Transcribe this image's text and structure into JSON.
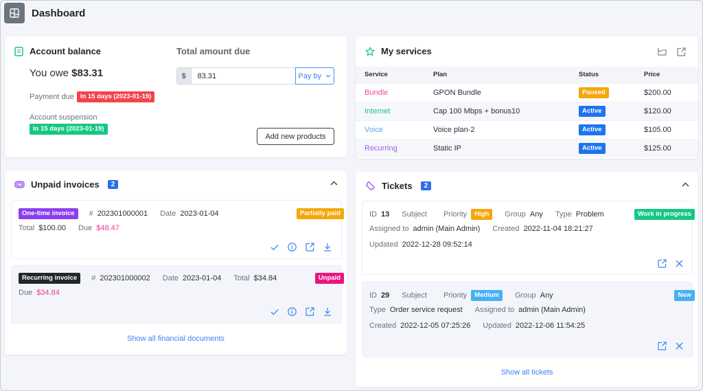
{
  "header": {
    "title": "Dashboard",
    "icon": "dashboard-layout-icon"
  },
  "account_balance": {
    "title": "Account balance",
    "icon": "receipt-icon",
    "you_owe_label": "You owe",
    "you_owe_amount": "$83.31",
    "payment_due_label": "Payment due",
    "payment_due_badge": "In 15 days (2023-01-19)",
    "suspension_label": "Account suspension",
    "suspension_badge": "In 15 days (2023-01-19)",
    "total_title": "Total amount due",
    "currency_symbol": "$",
    "amount_value": "83.31",
    "pay_by_label": "Pay by",
    "add_products_label": "Add new products"
  },
  "services": {
    "title": "My services",
    "icon": "star-icon",
    "actions": [
      "chart-icon",
      "external-link-icon"
    ],
    "columns": [
      "Service",
      "Plan",
      "Status",
      "Price"
    ],
    "rows": [
      {
        "service": "Bundle",
        "service_color": "#e8508e",
        "plan": "GPON Bundle",
        "status": "Paused",
        "status_color": "#f5a70a",
        "price": "$200.00"
      },
      {
        "service": "Internet",
        "service_color": "#19c38a",
        "plan": "Cap 100 Mbps + bonus10",
        "status": "Active",
        "status_color": "#1e74f0",
        "price": "$120.00"
      },
      {
        "service": "Voice",
        "service_color": "#5aa9f5",
        "plan": "Voice plan-2",
        "status": "Active",
        "status_color": "#1e74f0",
        "price": "$105.00"
      },
      {
        "service": "Recurring",
        "service_color": "#9b5cf0",
        "plan": "Static IP",
        "status": "Active",
        "status_color": "#1e74f0",
        "price": "$125.00"
      }
    ]
  },
  "invoices": {
    "title": "Unpaid invoices",
    "count": "2",
    "icon": "invoice-icon",
    "items": [
      {
        "type": "One-time invoice",
        "type_color": "#8a3ff0",
        "number_label": "#",
        "number": "202301000001",
        "date_label": "Date",
        "date": "2023-01-04",
        "total_label": "Total",
        "total": "$100.00",
        "due_label": "Due",
        "due": "$48.47",
        "status": "Partially paid",
        "status_color": "#f5a70a"
      },
      {
        "type": "Recurring invoice",
        "type_color": "#23272d",
        "number_label": "#",
        "number": "202301000002",
        "date_label": "Date",
        "date": "2023-01-04",
        "total_label": "Total",
        "total": "$34.84",
        "due_label": "Due",
        "due": "$34.84",
        "status": "Unpaid",
        "status_color": "#e8157f"
      }
    ],
    "show_all_label": "Show all financial documents"
  },
  "tickets": {
    "title": "Tickets",
    "count": "2",
    "icon": "ticket-icon",
    "items": [
      {
        "id_label": "ID",
        "id": "13",
        "subject_label": "Subject",
        "subject": "",
        "priority_label": "Priority",
        "priority": "High",
        "priority_color": "#f5a70a",
        "group_label": "Group",
        "group": "Any",
        "type_label": "Type",
        "type": "Problem",
        "assigned_label": "Assigned to",
        "assigned": "admin (Main Admin)",
        "created_label": "Created",
        "created": "2022-11-04 18:21:27",
        "updated_label": "Updated",
        "updated": "2022-12-28 09:52:14",
        "status": "Work in progress",
        "status_color": "#16c784"
      },
      {
        "id_label": "ID",
        "id": "29",
        "subject_label": "Subject",
        "subject": "",
        "priority_label": "Priority",
        "priority": "Medium",
        "priority_color": "#45b0f5",
        "group_label": "Group",
        "group": "Any",
        "type_label": "Type",
        "type": "Order service request",
        "assigned_label": "Assigned to",
        "assigned": "admin (Main Admin)",
        "created_label": "Created",
        "created": "2022-12-05 07:25:26",
        "updated_label": "Updated",
        "updated": "2022-12-06 11:54:25",
        "status": "New",
        "status_color": "#45b0f5"
      }
    ],
    "show_all_label": "Show all tickets"
  },
  "colors": {
    "accent": "#3b82f6",
    "danger": "#f2434e",
    "success": "#16c784",
    "pink": "#e83e8c"
  }
}
